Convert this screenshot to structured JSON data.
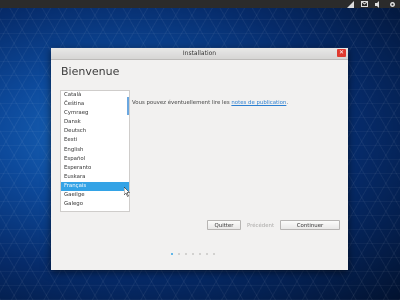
{
  "window": {
    "title": "Installation",
    "close_glyph": "✕"
  },
  "page": {
    "heading": "Bienvenue",
    "welcome_text_prefix": "Vous pouvez éventuellement lire les ",
    "welcome_link": "notes de publication",
    "welcome_text_suffix": "."
  },
  "languages": {
    "items": [
      "Català",
      "Čeština",
      "Cymraeg",
      "Dansk",
      "Deutsch",
      "Eesti",
      "English",
      "Español",
      "Esperanto",
      "Euskara",
      "Français",
      "Gaeilge",
      "Galego"
    ],
    "selected": "Français"
  },
  "buttons": {
    "quit": "Quitter",
    "previous": "Précédent",
    "continue": "Continuer"
  },
  "progress": {
    "total_steps": 7,
    "current_step": 1
  },
  "colors": {
    "accent": "#33a3e6",
    "close": "#e03a2f"
  },
  "icons": [
    "network-icon",
    "mail-icon",
    "speaker-icon",
    "settings-icon"
  ]
}
